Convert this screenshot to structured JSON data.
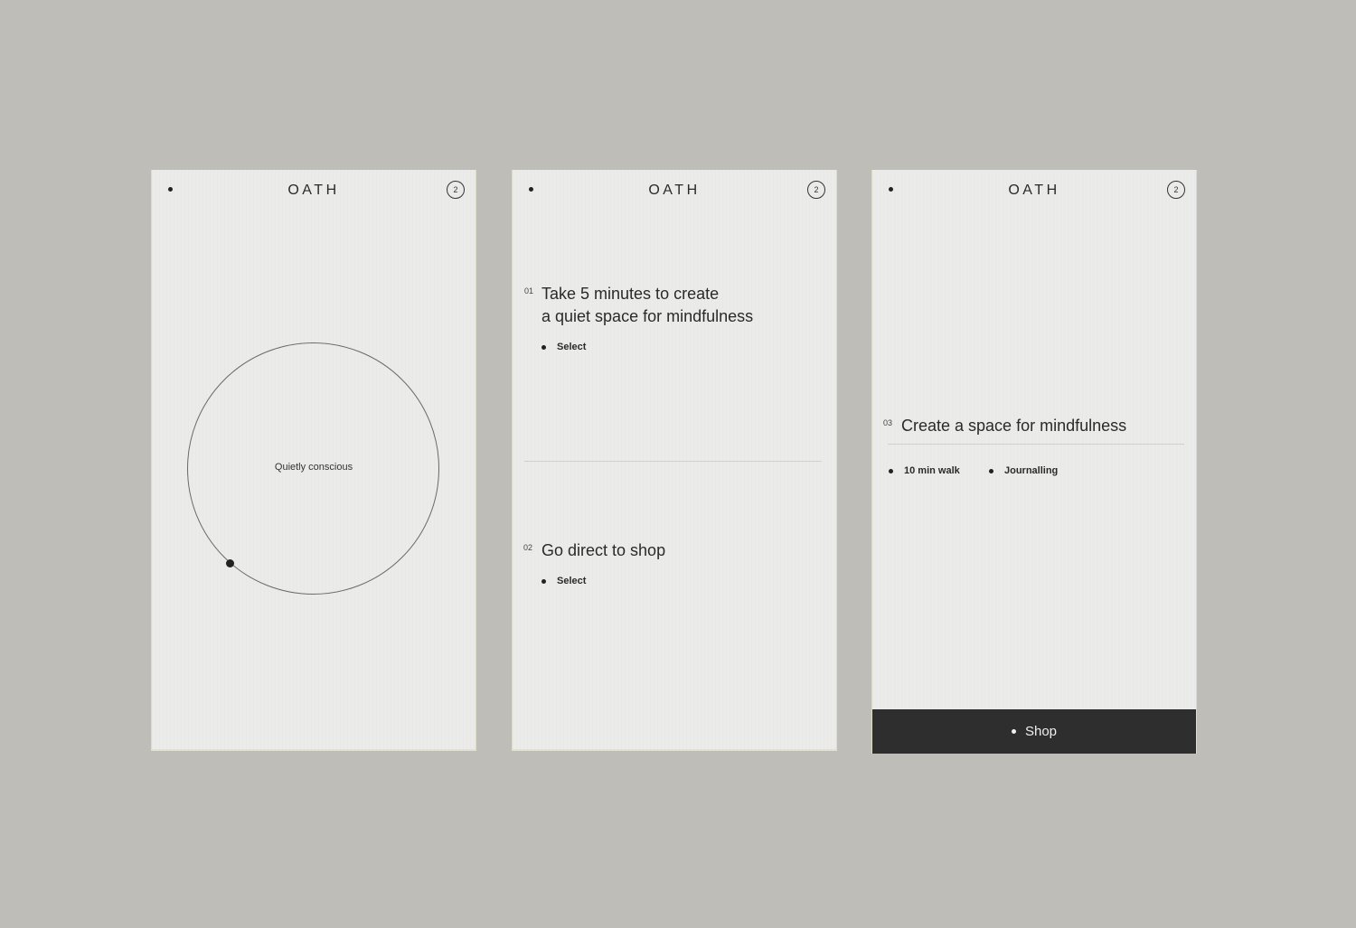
{
  "brand": "OATH",
  "cart_count": "2",
  "screens": [
    {
      "caption": "Quietly conscious"
    },
    {
      "options": [
        {
          "number": "01",
          "title_line1": "Take 5 minutes to create",
          "title_line2": "a quiet space for mindfulness",
          "action": "Select"
        },
        {
          "number": "02",
          "title_line1": "Go direct to shop",
          "action": "Select"
        }
      ]
    },
    {
      "number": "03",
      "title": "Create a space for mindfulness",
      "activities": [
        "10 min walk",
        "Journalling"
      ],
      "cta": "Shop"
    }
  ],
  "icons": {
    "menu": "menu-dot-icon",
    "cart": "cart-count-badge",
    "bullet": "bullet-dot-icon",
    "progress_marker": "progress-dot-icon"
  },
  "colors": {
    "backdrop": "#bebdb7",
    "screen": "#ebebea",
    "ink": "#262626",
    "shop_bar": "#2e2e2e"
  }
}
